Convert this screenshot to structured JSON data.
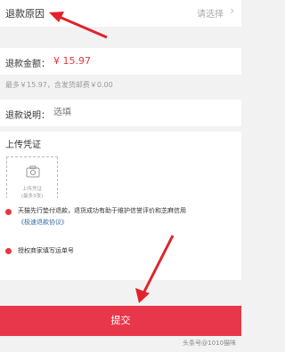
{
  "reason": {
    "label": "退款原因",
    "placeholder": "请选择"
  },
  "amount": {
    "label": "退款金额：",
    "value": "¥ 15.97"
  },
  "amount_hint": "最多￥15.97，含发货邮费￥0.00",
  "description": {
    "label": "退款说明：",
    "placeholder": "选填"
  },
  "upload": {
    "title": "上传凭证",
    "box_label": "上传凭证",
    "box_limit": "(最多3张)"
  },
  "agreement": {
    "item1_text": "天猫先行垫付退款，退货成功有助于维护信誉评价和芝麻信用",
    "item1_link": "《极速退款协议》",
    "item2_text": "授权商家填写运单号"
  },
  "submit_label": "提交",
  "watermark": "头条号@1010猫咪",
  "colors": {
    "accent": "#e4393c",
    "submit": "#e8374a",
    "link": "#3a6ea8"
  }
}
